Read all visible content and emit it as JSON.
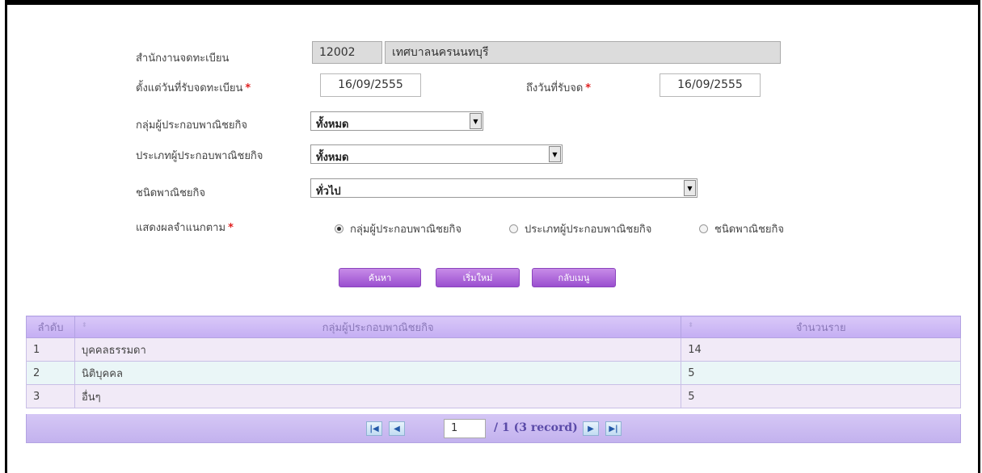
{
  "form": {
    "office_label": "สำนักงานจดทะเบียน",
    "office_code": "12002",
    "office_name": "เทศบาลนครนนทบุรี",
    "from_label": "ตั้งแต่วันที่รับจดทะเบียน",
    "from_value": "16/09/2555",
    "to_label": "ถึงวันที่รับจด",
    "to_value": "16/09/2555",
    "required_mark": "*",
    "group_label": "กลุ่มผู้ประกอบพาณิชยกิจ",
    "group_value": "ทั้งหมด",
    "type_label": "ประเภทผู้ประกอบพาณิชยกิจ",
    "type_value": "ทั้งหมด",
    "kind_label": "ชนิดพาณิชยกิจ",
    "kind_value": "ทั่วไป",
    "display_label": "แสดงผลจำแนกตาม",
    "radio_options": [
      "กลุ่มผู้ประกอบพาณิชยกิจ",
      "ประเภทผู้ประกอบพาณิชยกิจ",
      "ชนิดพาณิชยกิจ"
    ]
  },
  "buttons": {
    "search": "ค้นหา",
    "reset": "เริ่มใหม่",
    "back": "กลับเมนู"
  },
  "table": {
    "headers": [
      "ลำดับ",
      "กลุ่มผู้ประกอบพาณิชยกิจ",
      "จำนวนราย"
    ],
    "rows": [
      [
        "1",
        "บุคคลธรรมดา",
        "14"
      ],
      [
        "2",
        "นิติบุคคล",
        "5"
      ],
      [
        "3",
        "อื่นๆ",
        "5"
      ]
    ]
  },
  "pager": {
    "page": "1",
    "info": "/ 1  (3 record)"
  },
  "colors": {
    "button_purple": "#9a4fcf",
    "header_lavender": "#c4aef3",
    "required_red": "#e02020"
  }
}
